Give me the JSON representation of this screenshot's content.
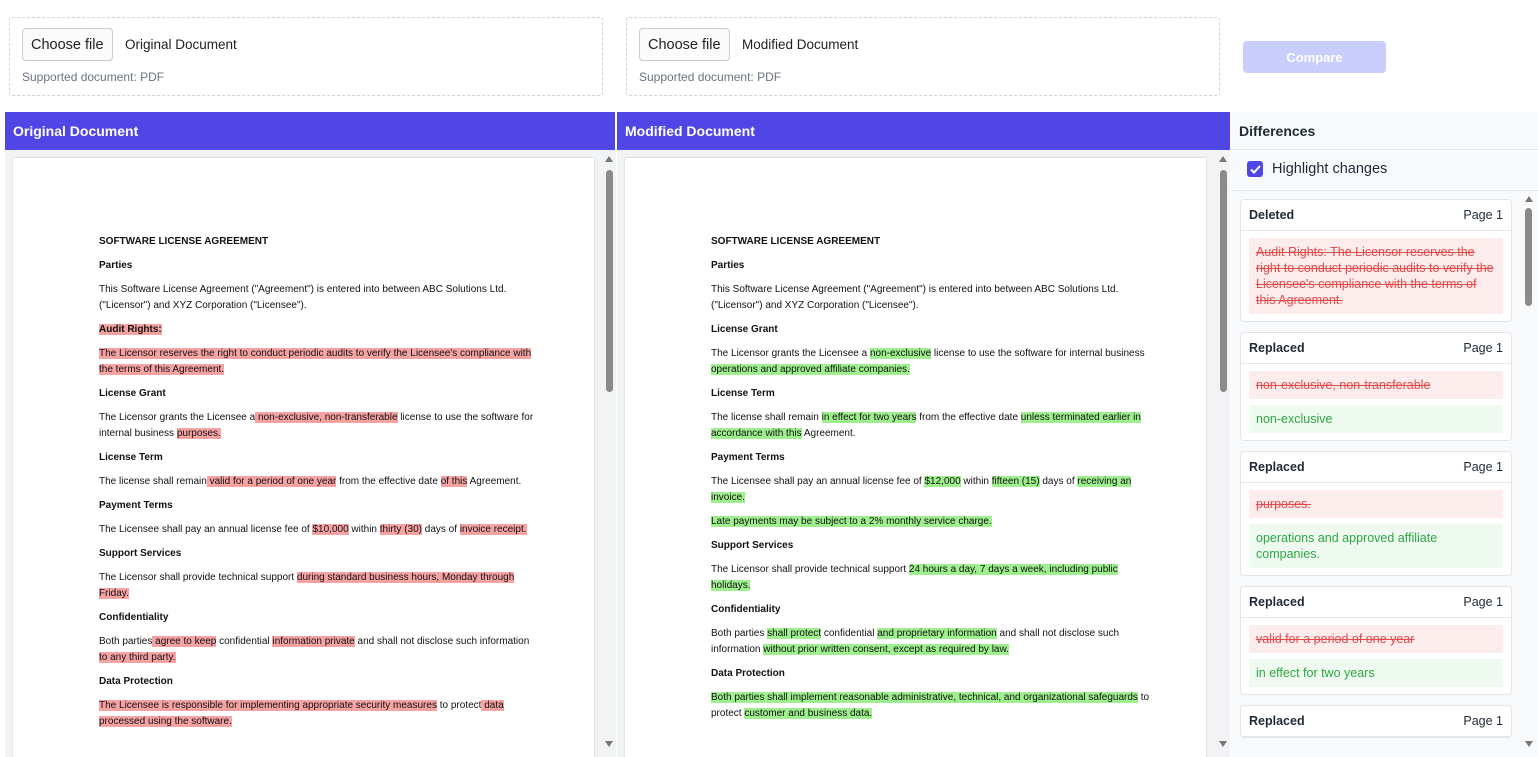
{
  "upload": {
    "original": {
      "button": "Choose file",
      "file_name": "Original Document",
      "supported": "Supported document: PDF"
    },
    "modified": {
      "button": "Choose file",
      "file_name": "Modified Document",
      "supported": "Supported document: PDF"
    },
    "compare_label": "Compare"
  },
  "panels": {
    "original_title": "Original Document",
    "modified_title": "Modified Document",
    "differences_title": "Differences"
  },
  "highlight_label": "Highlight changes",
  "original_doc": {
    "title": "SOFTWARE LICENSE AGREEMENT",
    "parties_h": "Parties",
    "parties_p": "This Software License Agreement (\"Agreement\") is entered into between ABC Solutions Ltd. (\"Licensor\") and XYZ Corporation (\"Licensee\").",
    "audit_h": "Audit Rights:",
    "audit_p": "The Licensor reserves the right to conduct periodic audits to verify the Licensee's compliance with the terms of this Agreement.",
    "grant_h": "License Grant",
    "grant_a": "The Licensor grants the Licensee a",
    "grant_del": " non-exclusive, non-transferable",
    "grant_b": " license to use the software for internal business ",
    "grant_del2": "purposes.",
    "term_h": "License Term",
    "term_a": "The license shall remain",
    "term_del": " valid for a period of one year",
    "term_b": " from the effective date ",
    "term_del2": "of this",
    "term_c": " Agreement.",
    "pay_h": "Payment Terms",
    "pay_a": "The Licensee shall pay an annual license fee of ",
    "pay_del": "$10,000",
    "pay_b": " within ",
    "pay_del2": "thirty (30)",
    "pay_c": " days of ",
    "pay_del3": "invoice receipt.",
    "support_h": "Support Services",
    "support_a": "The Licensor shall provide technical support ",
    "support_del": "during standard business hours, Monday through Friday.",
    "conf_h": "Confidentiality",
    "conf_a": "Both parties",
    "conf_del": " agree to keep",
    "conf_b": " confidential ",
    "conf_del2": "information private",
    "conf_c": " and shall not disclose such information",
    "conf_del3": " to any third party.",
    "dp_h": "Data Protection",
    "dp_del": "The Licensee is responsible for implementing appropriate security measures",
    "dp_a": " to protect",
    "dp_del2": " data processed using the software."
  },
  "modified_doc": {
    "title": "SOFTWARE LICENSE AGREEMENT",
    "parties_h": "Parties",
    "parties_p": "This Software License Agreement (\"Agreement\") is entered into between ABC Solutions Ltd. (\"Licensor\") and XYZ Corporation (\"Licensee\").",
    "grant_h": "License Grant",
    "grant_a": "The Licensor grants the Licensee a ",
    "grant_ins": "non-exclusive",
    "grant_b": " license to use the software for internal business ",
    "grant_ins2": "operations and approved affiliate companies.",
    "term_h": "License Term",
    "term_a": "The license shall remain ",
    "term_ins": "in effect for two years",
    "term_b": " from the effective date ",
    "term_ins2": "unless terminated earlier in accordance with this",
    "term_c": " Agreement.",
    "pay_h": "Payment Terms",
    "pay_a": "The Licensee shall pay an annual license fee of ",
    "pay_ins": "$12,000",
    "pay_b": " within ",
    "pay_ins2": "fifteen (15)",
    "pay_c": " days of ",
    "pay_ins3": "receiving an invoice.",
    "late_ins": "Late payments may be subject to a 2% monthly service charge.",
    "support_h": "Support Services",
    "support_a": "The Licensor shall provide technical support ",
    "support_ins": "24 hours a day, 7 days a week, including public holidays.",
    "conf_h": "Confidentiality",
    "conf_a": "Both parties ",
    "conf_ins": "shall protect",
    "conf_b": " confidential ",
    "conf_ins2": "and proprietary information",
    "conf_c": " and shall not disclose such information ",
    "conf_ins3": "without prior written consent, except as required by law.",
    "dp_h": "Data Protection",
    "dp_ins": "Both parties shall implement reasonable administrative, technical, and organizational safeguards",
    "dp_a": " to protect ",
    "dp_ins2": "customer and business data."
  },
  "differences": [
    {
      "type": "Deleted",
      "page": "Page 1",
      "old": "Audit Rights: The Licensor reserves the right to conduct periodic audits to verify the Licensee's compliance with the terms of this Agreement.",
      "new": ""
    },
    {
      "type": "Replaced",
      "page": "Page 1",
      "old": "non-exclusive, non-transferable",
      "new": "non-exclusive"
    },
    {
      "type": "Replaced",
      "page": "Page 1",
      "old": "purposes.",
      "new": "operations and approved affiliate companies."
    },
    {
      "type": "Replaced",
      "page": "Page 1",
      "old": "valid for a period of one year",
      "new": "in effect for two years"
    },
    {
      "type": "Replaced",
      "page": "Page 1",
      "old": "",
      "new": ""
    }
  ],
  "colors": {
    "accent": "#5046e5",
    "deleted_bg": "#f7a3a3",
    "inserted_bg": "#9ef08e",
    "old_text": "#e24b4b",
    "new_text": "#2fa646"
  }
}
